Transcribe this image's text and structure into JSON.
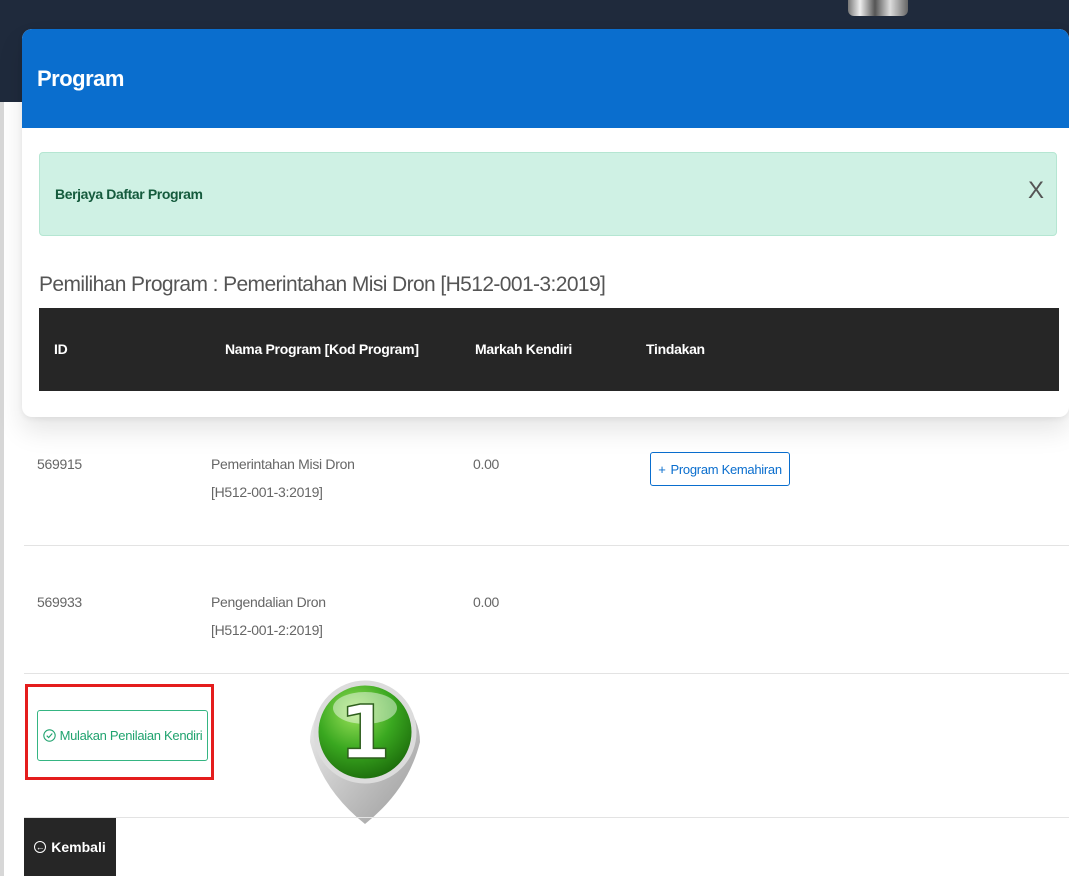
{
  "card": {
    "title": "Program"
  },
  "alert": {
    "message": "Berjaya Daftar Program",
    "close_label": "X"
  },
  "selection": {
    "title": "Pemilihan Program : Pemerintahan Misi Dron [H512-001-3:2019]"
  },
  "table": {
    "headers": {
      "id": "ID",
      "name": "Nama Program [Kod Program]",
      "score": "Markah Kendiri",
      "action": "Tindakan"
    },
    "rows": [
      {
        "id": "569915",
        "name_line1": "Pemerintahan Misi Dron",
        "name_line2": "[H512-001-3:2019]",
        "score": "0.00",
        "action_label": "Program Kemahiran",
        "action_icon": "+"
      },
      {
        "id": "569933",
        "name_line1": "Pengendalian Dron",
        "name_line2": "[H512-001-2:2019]",
        "score": "0.00"
      }
    ]
  },
  "actions": {
    "start_label": "Mulakan Penilaian Kendiri",
    "start_icon": "check-circle-icon",
    "back_label": "Kembali",
    "back_icon": "arrow-left-circle-icon"
  },
  "annotation": {
    "step_number": "1"
  },
  "colors": {
    "header_blue": "#0a6ece",
    "dark": "#262626",
    "success_bg": "#cff1e4",
    "success_text": "#155b3d",
    "highlight_red": "#e41d1d",
    "green": "#20a36f"
  }
}
